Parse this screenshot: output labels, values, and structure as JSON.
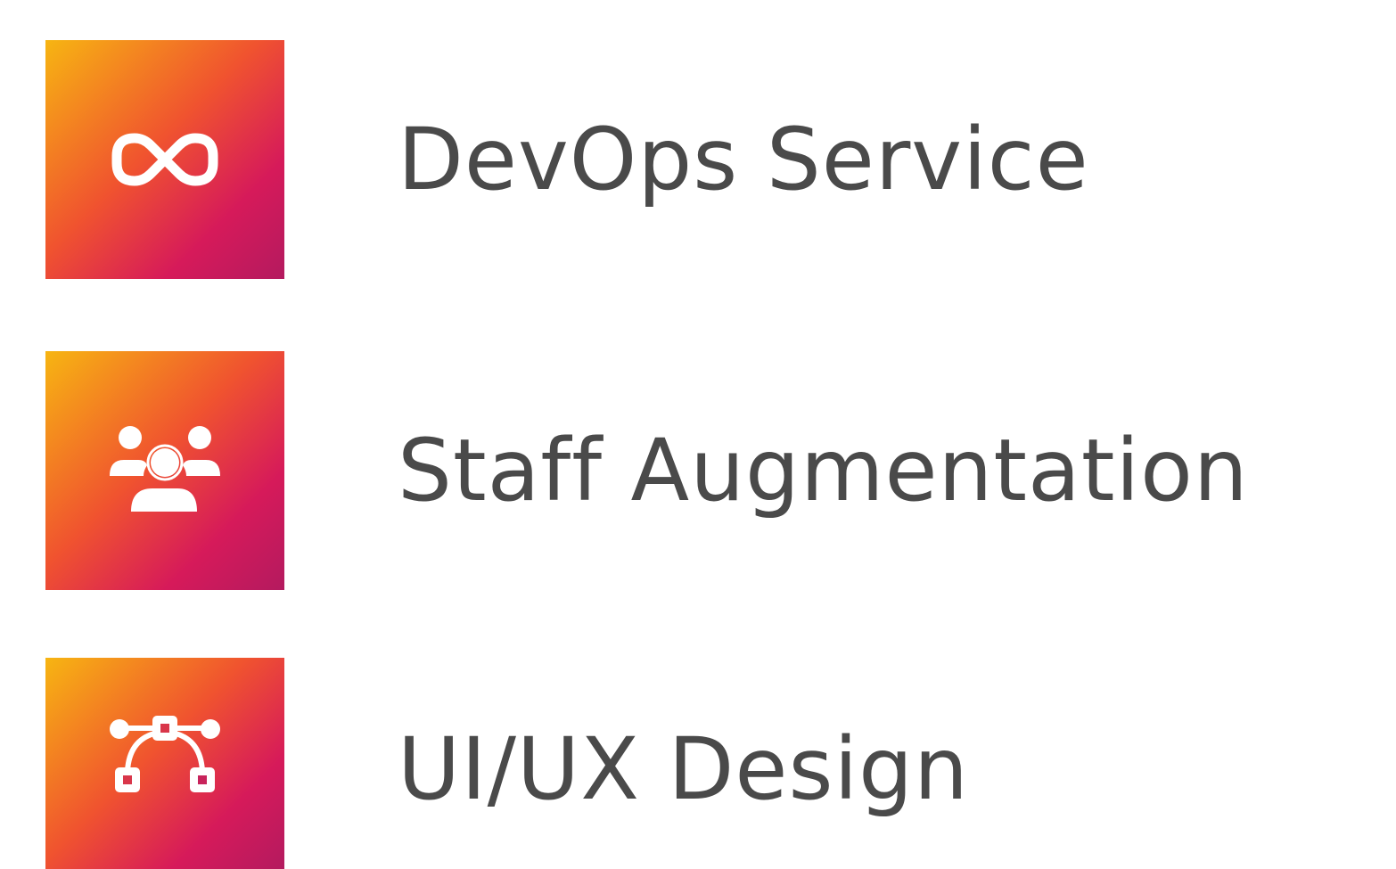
{
  "services": [
    {
      "label": "DevOps Service",
      "icon": "infinity-icon"
    },
    {
      "label": "Staff Augmentation",
      "icon": "team-icon"
    },
    {
      "label": "UI/UX Design",
      "icon": "vector-pen-icon"
    }
  ],
  "colors": {
    "gradient_start": "#f7b512",
    "gradient_mid": "#f0532f",
    "gradient_end": "#d61a5a",
    "text": "#4a4a4a",
    "icon": "#ffffff"
  }
}
